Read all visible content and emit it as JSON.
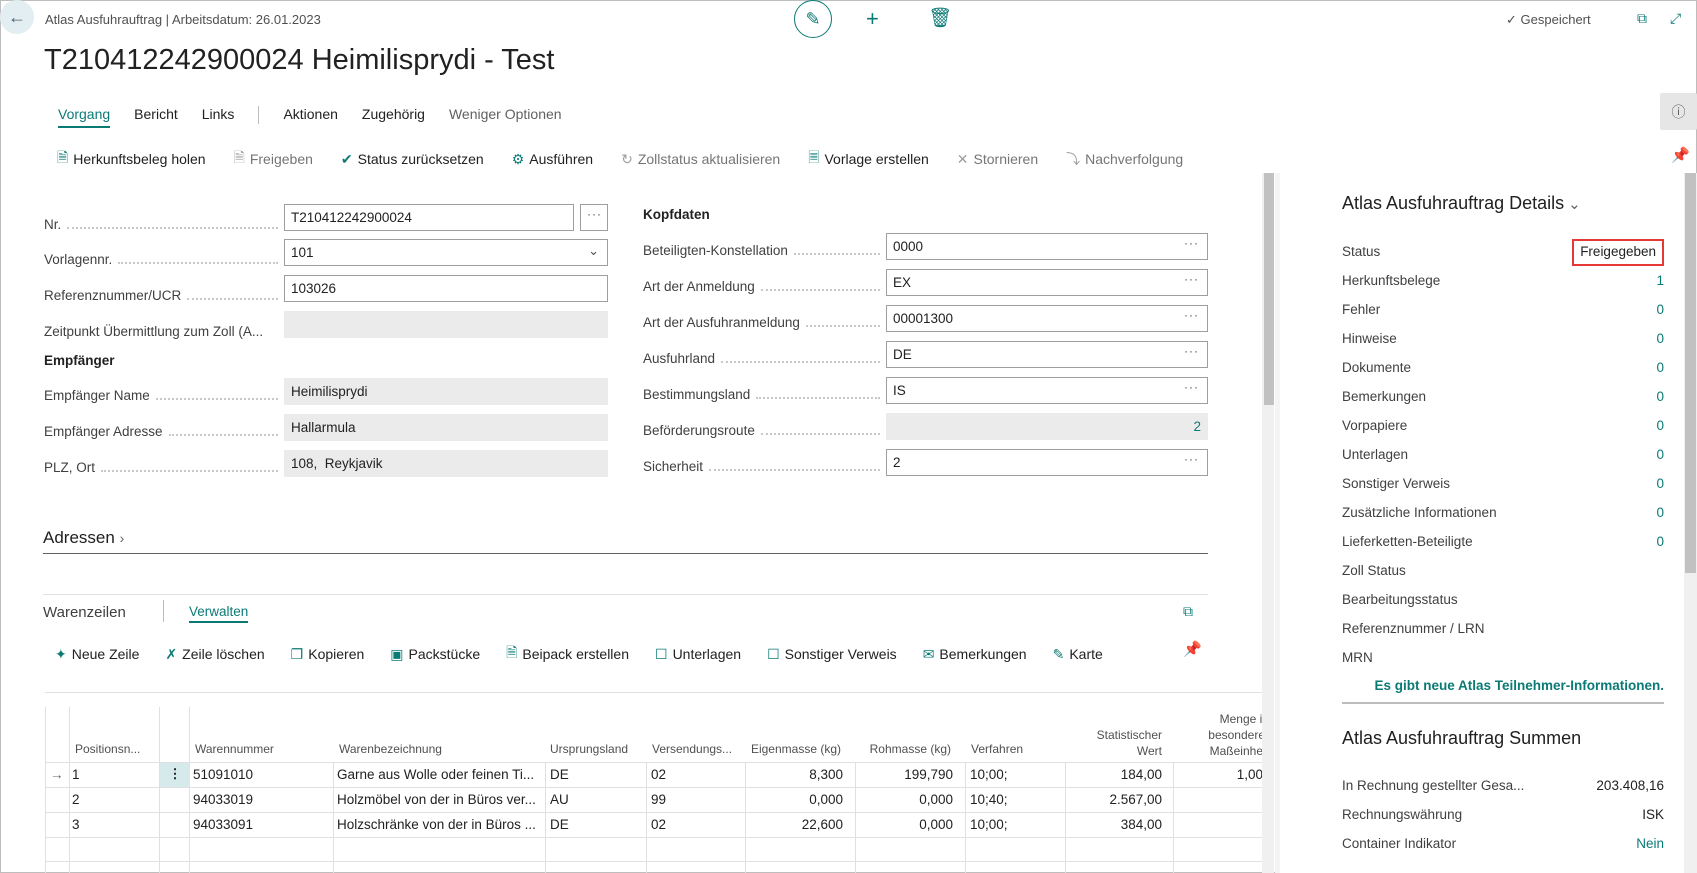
{
  "header": {
    "breadcrumb": "Atlas Ausfuhrauftrag | Arbeitsdatum: 26.01.2023",
    "title": "T210412242900024 Heimilisprydi - Test",
    "saved_label": "Gespeichert"
  },
  "nav": {
    "tabs": [
      "Vorgang",
      "Bericht",
      "Links",
      "Aktionen",
      "Zugehörig",
      "Weniger Optionen"
    ]
  },
  "actions": {
    "items": [
      "Herkunftsbeleg holen",
      "Freigeben",
      "Status zurücksetzen",
      "Ausführen",
      "Zollstatus aktualisieren",
      "Vorlage erstellen",
      "Stornieren",
      "Nachverfolgung"
    ]
  },
  "form_left": {
    "nr_label": "Nr.",
    "nr_value": "T210412242900024",
    "vorlage_label": "Vorlagennr.",
    "vorlage_value": "101",
    "ref_label": "Referenznummer/UCR",
    "ref_value": "103026",
    "zeitpunkt_label": "Zeitpunkt Übermittlung zum Zoll (A...",
    "zeitpunkt_value": "",
    "empf_section": "Empfänger",
    "empf_name_label": "Empfänger Name",
    "empf_name_value": "Heimilisprydi",
    "empf_addr_label": "Empfänger Adresse",
    "empf_addr_value": "Hallarmula",
    "plz_label": "PLZ, Ort",
    "plz_value": "108,  Reykjavik"
  },
  "form_right": {
    "section": "Kopfdaten",
    "beteiligte_label": "Beteiligten-Konstellation",
    "beteiligte_value": "0000",
    "art_label": "Art der Anmeldung",
    "art_value": "EX",
    "artaus_label": "Art der Ausfuhranmeldung",
    "artaus_value": "00001300",
    "ausfuhrland_label": "Ausfuhrland",
    "ausfuhrland_value": "DE",
    "bestimmung_label": "Bestimmungsland",
    "bestimmung_value": "IS",
    "route_label": "Beförderungsroute",
    "route_value": "2",
    "sicherheit_label": "Sicherheit",
    "sicherheit_value": "2"
  },
  "adressen": "Adressen",
  "lines": {
    "title": "Warenzeilen",
    "manage": "Verwalten",
    "actions": [
      "Neue Zeile",
      "Zeile löschen",
      "Kopieren",
      "Packstücke",
      "Beipack erstellen",
      "Unterlagen",
      "Sonstiger Verweis",
      "Bemerkungen",
      "Karte"
    ],
    "columns": [
      "Positionsn...",
      "Warennummer",
      "Warenbezeichnung",
      "Ursprungsland",
      "Versendungs...",
      "Eigenmasse (kg)",
      "Rohmasse (kg)",
      "Verfahren",
      "Statistischer Wert",
      "Menge in besonderer Maßeinheit"
    ],
    "rows": [
      [
        "1",
        "51091010",
        "Garne aus Wolle oder feinen Ti...",
        "DE",
        "02",
        "8,300",
        "199,790",
        "10;00;",
        "184,00",
        "1,00"
      ],
      [
        "2",
        "94033019",
        "Holzmöbel von der in Büros ver...",
        "AU",
        "99",
        "0,000",
        "0,000",
        "10;40;",
        "2.567,00",
        ""
      ],
      [
        "3",
        "94033091",
        "Holzschränke von der in Büros ...",
        "DE",
        "02",
        "22,600",
        "0,000",
        "10;00;",
        "384,00",
        ""
      ]
    ]
  },
  "details": {
    "title": "Atlas Ausfuhrauftrag Details",
    "rows": [
      {
        "label": "Status",
        "value": "Freigegeben"
      },
      {
        "label": "Herkunftsbelege",
        "value": "1"
      },
      {
        "label": "Fehler",
        "value": "0"
      },
      {
        "label": "Hinweise",
        "value": "0"
      },
      {
        "label": "Dokumente",
        "value": "0"
      },
      {
        "label": "Bemerkungen",
        "value": "0"
      },
      {
        "label": "Vorpapiere",
        "value": "0"
      },
      {
        "label": "Unterlagen",
        "value": "0"
      },
      {
        "label": "Sonstiger Verweis",
        "value": "0"
      },
      {
        "label": "Zusätzliche Informationen",
        "value": "0"
      },
      {
        "label": "Lieferketten-Beteiligte",
        "value": "0"
      },
      {
        "label": "Zoll Status",
        "value": ""
      },
      {
        "label": "Bearbeitungsstatus",
        "value": ""
      },
      {
        "label": "Referenznummer / LRN",
        "value": ""
      },
      {
        "label": "MRN",
        "value": ""
      }
    ],
    "notice": "Es gibt neue Atlas Teilnehmer-Informationen."
  },
  "summen": {
    "title": "Atlas Ausfuhrauftrag Summen",
    "rows": [
      {
        "label": "In Rechnung gestellter Gesa...",
        "value": "203.408,16"
      },
      {
        "label": "Rechnungswährung",
        "value": "ISK"
      },
      {
        "label": "Container Indikator",
        "value": "Nein"
      }
    ]
  },
  "colors": {
    "accent": "#0b7a75",
    "highlight": "#e53935"
  }
}
